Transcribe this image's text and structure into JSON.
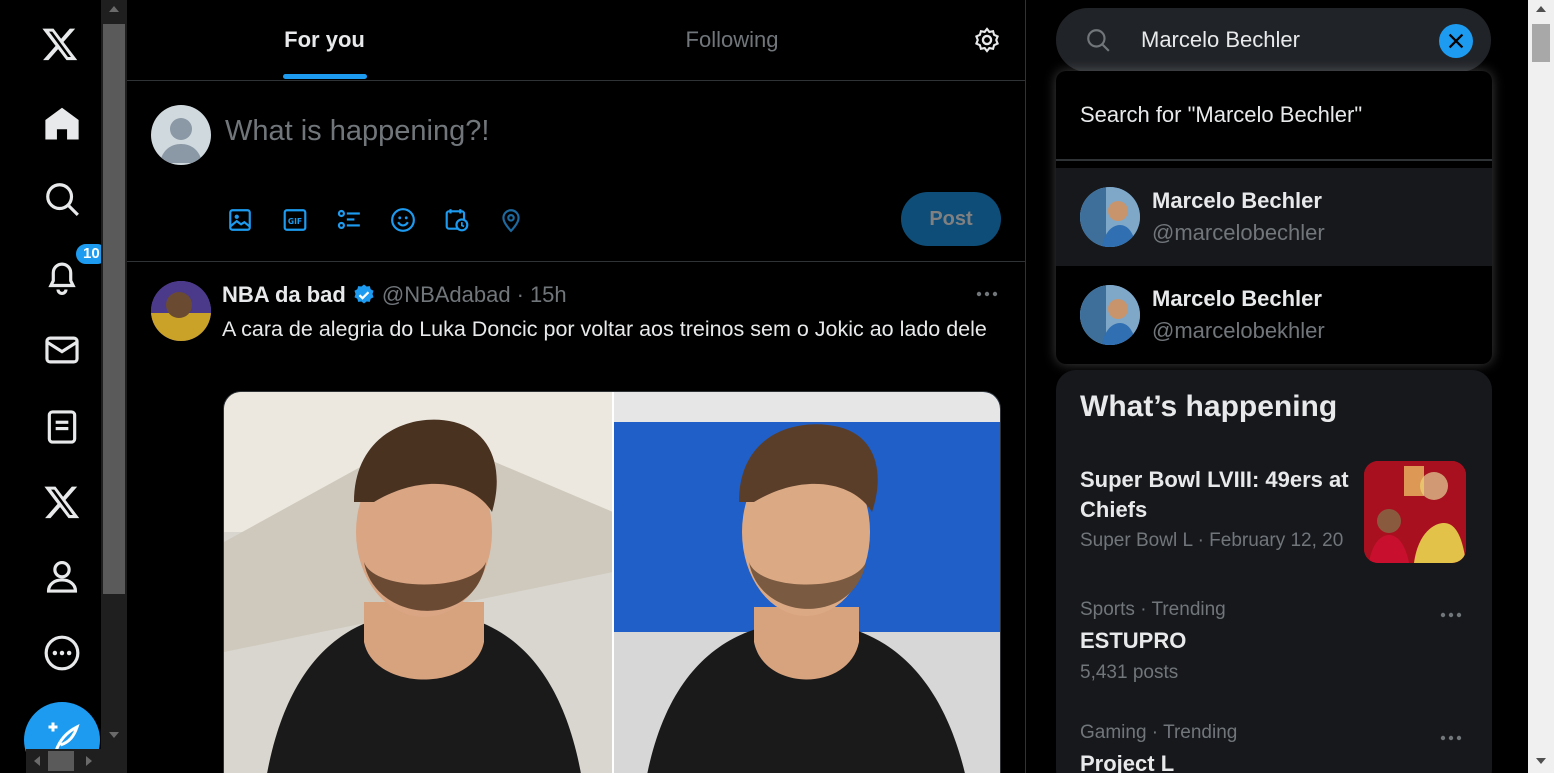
{
  "colors": {
    "accent": "#1d9bf0",
    "background": "#000000",
    "muted_text": "#71767b",
    "post_button_disabled": "#0e4d78"
  },
  "nav": {
    "items": [
      {
        "icon": "x-logo-icon"
      },
      {
        "icon": "home-icon"
      },
      {
        "icon": "search-icon"
      },
      {
        "icon": "notifications-bell-icon",
        "badge": "10"
      },
      {
        "icon": "messages-envelope-icon"
      },
      {
        "icon": "lists-icon"
      },
      {
        "icon": "premium-x-icon"
      },
      {
        "icon": "profile-person-icon"
      },
      {
        "icon": "more-circle-icon"
      }
    ],
    "compose_icon": "compose-feather-icon"
  },
  "header": {
    "tabs": [
      {
        "label": "For you",
        "active": true
      },
      {
        "label": "Following",
        "active": false
      }
    ],
    "settings_icon": "gear-icon"
  },
  "composer": {
    "placeholder": "What is happening?!",
    "tools": [
      "image-icon",
      "gif-icon",
      "poll-icon",
      "emoji-icon",
      "schedule-icon",
      "location-icon"
    ],
    "post_label": "Post"
  },
  "tweet": {
    "name": "NBA da bad",
    "handle": "@NBAdabad",
    "dot": "·",
    "time": "15h",
    "text": "A cara de alegria do Luka Doncic por voltar aos treinos sem o Jokic ao lado dele"
  },
  "search": {
    "query": "Marcelo Bechler",
    "search_for_label": "Search for \"Marcelo Bechler\"",
    "results": [
      {
        "name": "Marcelo Bechler",
        "handle": "@marcelobechler"
      },
      {
        "name": "Marcelo Bechler",
        "handle": "@marcelobekhler"
      }
    ]
  },
  "happening": {
    "title": "What’s happening",
    "trends": [
      {
        "title": "Super Bowl LVIII: 49ers at Chiefs",
        "meta": "Super Bowl L · February 12, 20"
      },
      {
        "meta": "Sports · Trending",
        "title": "ESTUPRO",
        "posts": "5,431 posts"
      },
      {
        "meta": "Gaming · Trending",
        "title": "Project L"
      }
    ]
  }
}
